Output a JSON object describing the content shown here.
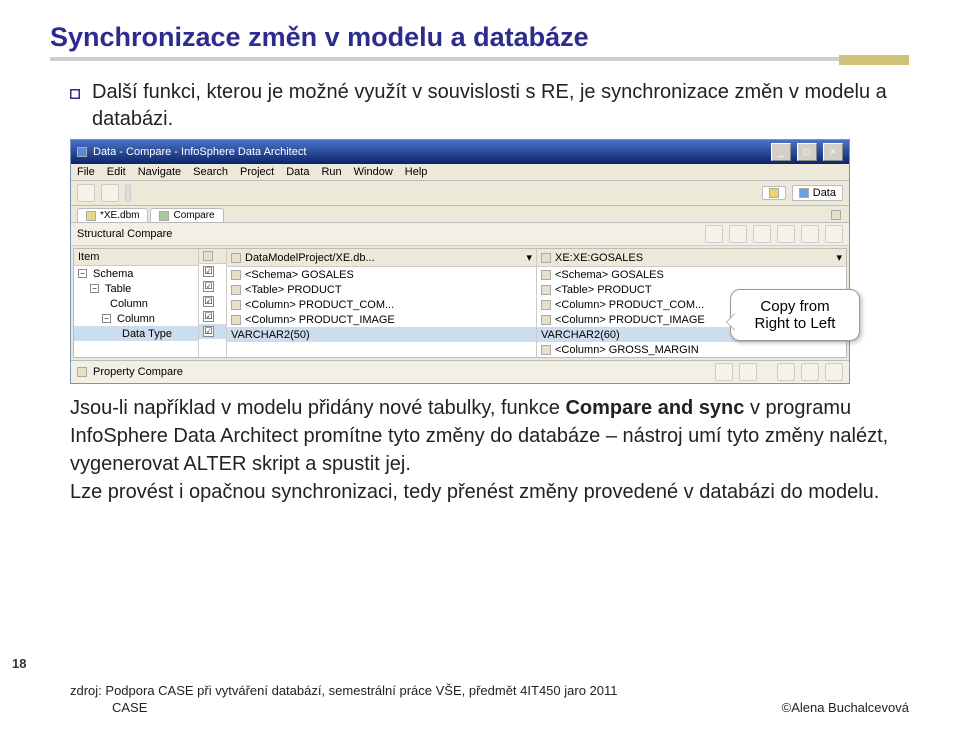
{
  "title": "Synchronizace změn v modelu a databáze",
  "intro": "Další funkci, kterou je možné využít v souvislosti s RE, je synchronizace změn v modelu a databázi.",
  "body_part1": "Jsou-li například v modelu přidány nové tabulky, funkce ",
  "body_bold": "Compare and sync",
  "body_part2": " v programu InfoSphere Data Architect promítne tyto změny do databáze – nástroj umí tyto změny nalézt, vygenerovat ALTER skript a spustit jej.",
  "body2": "Lze provést i opačnou synchronizaci, tedy přenést změny provedené v databázi do modelu.",
  "page_num": "18",
  "footer_source": "zdroj: Podpora CASE při vytváření databází, semestrální práce VŠE, předmět 4IT450 jaro 2011",
  "footer_left": "CASE",
  "footer_right": "©Alena Buchalcevová",
  "screenshot": {
    "winTitle": "Data - Compare - InfoSphere Data Architect",
    "menus": [
      "File",
      "Edit",
      "Navigate",
      "Search",
      "Project",
      "Data",
      "Run",
      "Window",
      "Help"
    ],
    "perspective": "Data",
    "tabs": [
      "*XE.dbm",
      "Compare"
    ],
    "panelHeader": "Structural Compare",
    "leftHeader": "Item",
    "leftRows": [
      {
        "toggle": "-",
        "label": "Schema",
        "indent": 0
      },
      {
        "toggle": "-",
        "label": "Table",
        "indent": 1
      },
      {
        "toggle": "",
        "label": "Column",
        "indent": 2
      },
      {
        "toggle": "-",
        "label": "Column",
        "indent": 2
      },
      {
        "toggle": "",
        "label": "Data Type",
        "indent": 3
      },
      {
        "toggle": "",
        "label": "",
        "indent": 2
      }
    ],
    "checks": [
      "☑",
      "☑",
      "☑",
      "☑",
      "☑",
      ""
    ],
    "colAHeader": "DataModelProject/XE.db...",
    "colARows": [
      "<Schema> GOSALES",
      "<Table> PRODUCT",
      "<Column> PRODUCT_COM...",
      "<Column> PRODUCT_IMAGE",
      "VARCHAR2(50)",
      ""
    ],
    "colBHeader": "XE:XE:GOSALES",
    "colBRows": [
      "<Schema> GOSALES",
      "<Table> PRODUCT",
      "<Column> PRODUCT_COM...",
      "<Column> PRODUCT_IMAGE",
      "VARCHAR2(60)",
      "<Column> GROSS_MARGIN"
    ],
    "callout": "Copy from Right to Left",
    "bottomPanel": "Property Compare"
  }
}
